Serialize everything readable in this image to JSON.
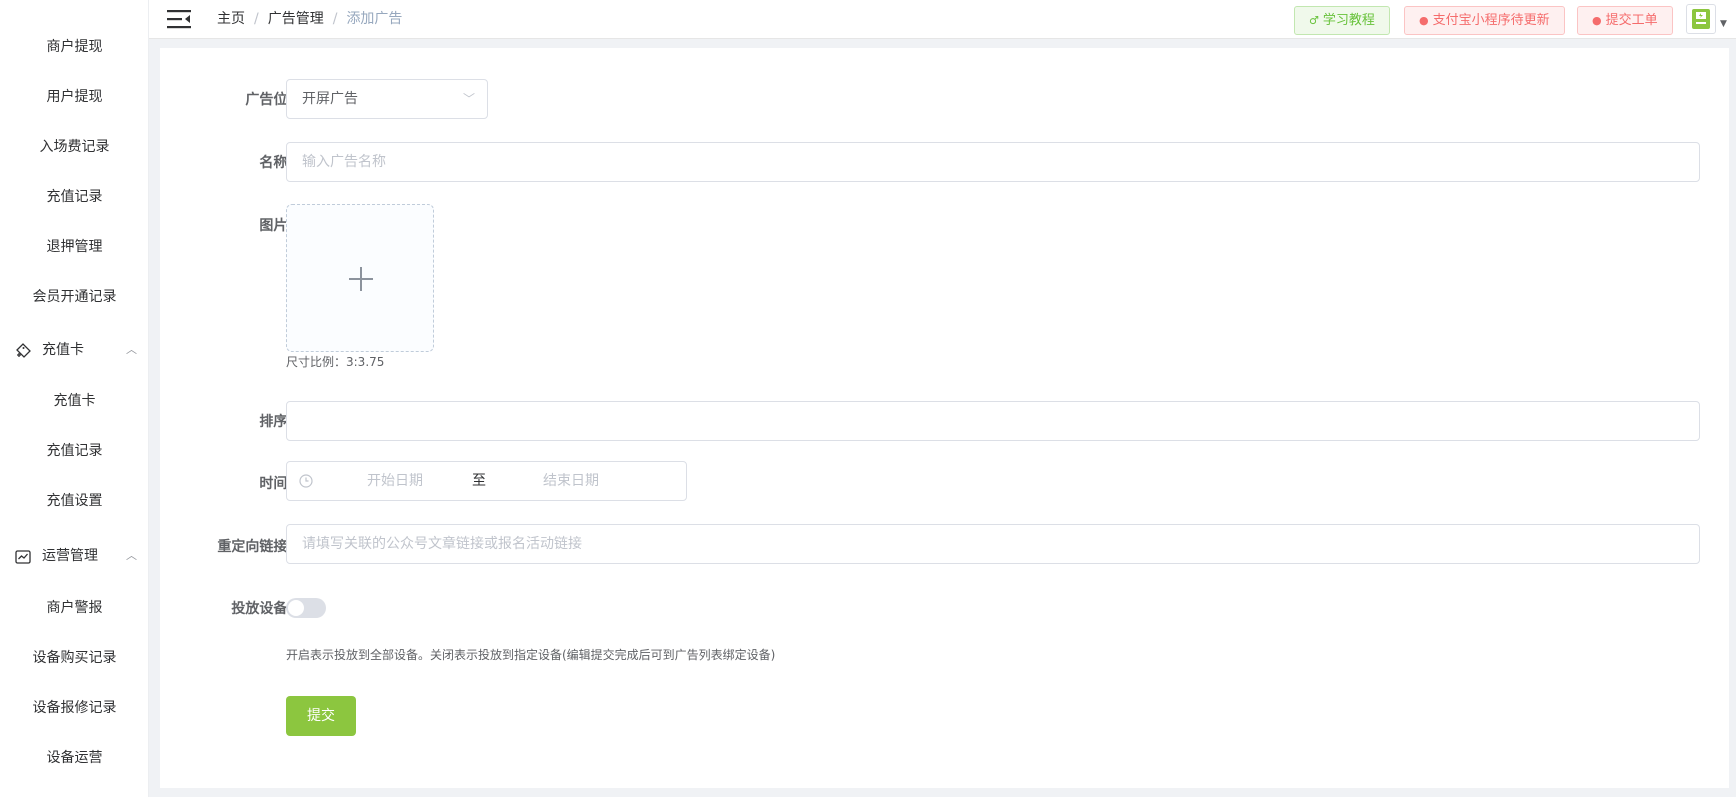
{
  "sidebar": {
    "items_top": [
      "商户提现",
      "用户提现",
      "入场费记录",
      "充值记录",
      "退押管理",
      "会员开通记录"
    ],
    "group_recharge_card": {
      "label": "充值卡",
      "icon": "ticket-icon",
      "expanded": true
    },
    "items_recharge": [
      "充值卡",
      "充值记录",
      "充值设置"
    ],
    "group_operations": {
      "label": "运营管理",
      "icon": "chart-line-icon",
      "expanded": true
    },
    "items_operations": [
      "商户警报",
      "设备购买记录",
      "设备报修记录",
      "设备运营"
    ]
  },
  "header": {
    "breadcrumb": [
      "主页",
      "广告管理",
      "添加广告"
    ],
    "buttons": {
      "tutorial": "学习教程",
      "alipay_update": "支付宝小程序待更新",
      "ticket": "提交工单"
    }
  },
  "form": {
    "ad_position": {
      "label": "广告位:",
      "value": "开屏广告"
    },
    "name": {
      "label": "名称:",
      "placeholder": "输入广告名称"
    },
    "image": {
      "label": "图片:",
      "hint": "尺寸比例：3:3.75"
    },
    "sort": {
      "label": "排序:",
      "value": ""
    },
    "time": {
      "label": "时间:",
      "start_placeholder": "开始日期",
      "separator": "至",
      "end_placeholder": "结束日期"
    },
    "redirect": {
      "label": "重定向链接:",
      "placeholder": "请填写关联的公众号文章链接或报名活动链接"
    },
    "devices": {
      "label": "投放设备:",
      "enabled": false,
      "hint": "开启表示投放到全部设备。关闭表示投放到指定设备(编辑提交完成后可到广告列表绑定设备)"
    },
    "submit_label": "提交"
  },
  "colors": {
    "primary_green": "#8cc63f",
    "tag_green": "#67c23a",
    "tag_red": "#f56c6c"
  }
}
